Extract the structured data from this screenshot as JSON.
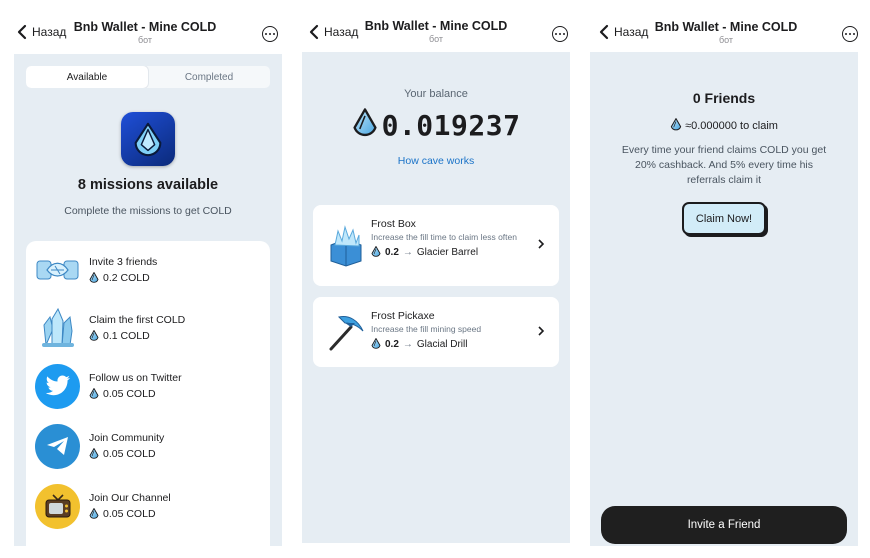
{
  "nav": {
    "back_label": "Назад",
    "title": "Bnb Wallet - Mine COLD",
    "subtitle": "бот"
  },
  "colors": {
    "panel_bg": "#e6edf3",
    "accent_link": "#1a73c8",
    "claim_button_bg": "#d2ecf8",
    "invite_button_bg": "#1f1f1f",
    "twitter_blue": "#1d9bf0",
    "telegram_blue": "#2a8fd4"
  },
  "missions_screen": {
    "tabs": [
      {
        "label": "Available",
        "active": true
      },
      {
        "label": "Completed",
        "active": false
      }
    ],
    "count_number": "8",
    "count_label": "missions available",
    "subtitle": "Complete the missions to get COLD",
    "missions": [
      {
        "name": "Invite 3 friends",
        "reward": "0.2 COLD",
        "icon": "ice-handshake-icon"
      },
      {
        "name": "Claim the first COLD",
        "reward": "0.1 COLD",
        "icon": "ice-crystal-icon"
      },
      {
        "name": "Follow us on Twitter",
        "reward": "0.05 COLD",
        "icon": "twitter-bird-icon"
      },
      {
        "name": "Join Community",
        "reward": "0.05 COLD",
        "icon": "telegram-plane-icon"
      },
      {
        "name": "Join Our Channel",
        "reward": "0.05 COLD",
        "icon": "tv-icon"
      }
    ]
  },
  "cave_screen": {
    "balance_label": "Your balance",
    "balance_value": "0.019237",
    "how_link": "How cave works",
    "upgrades": [
      {
        "name": "Frost Box",
        "description": "Increase the fill time to claim less often",
        "cost": "0.2",
        "arrow": "→",
        "next": "Glacier Barrel",
        "icon": "ice-box-icon"
      },
      {
        "name": "Frost Pickaxe",
        "description": "Increase the fill mining speed",
        "cost": "0.2",
        "arrow": "→",
        "next": "Glacial Drill",
        "icon": "ice-pickaxe-icon"
      }
    ]
  },
  "friends_screen": {
    "title": "0 Friends",
    "claim_text": "≈0.000000 to claim",
    "description": "Every time your friend claims COLD you get 20% cashback. And 5% every time his referrals claim it",
    "claim_button": "Claim Now!",
    "invite_button": "Invite a Friend"
  }
}
